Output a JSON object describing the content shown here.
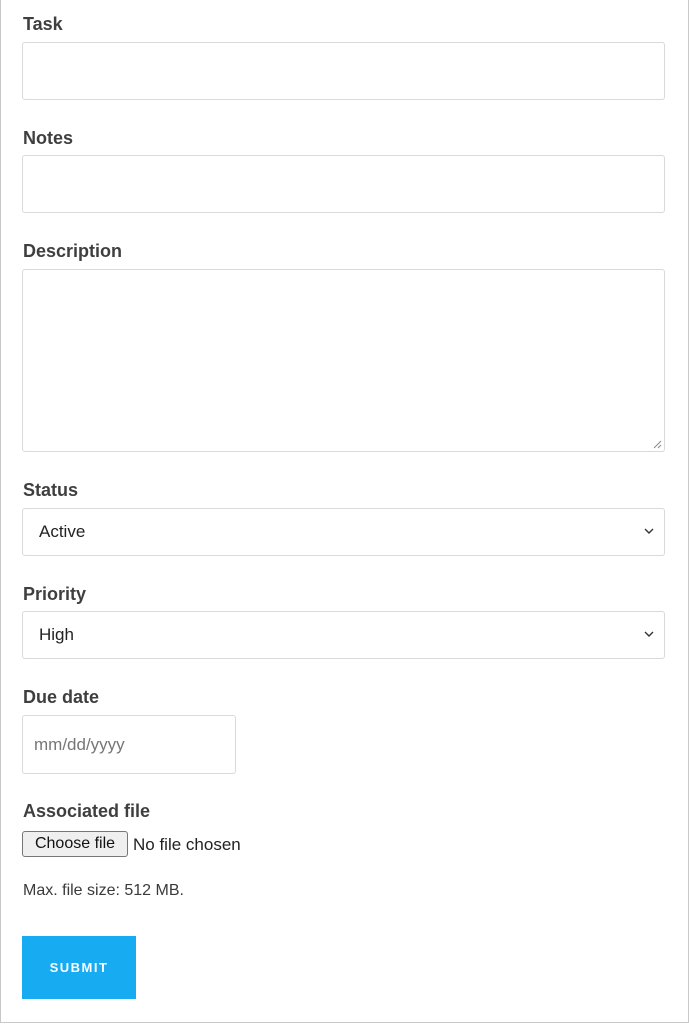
{
  "form": {
    "task": {
      "label": "Task",
      "value": ""
    },
    "notes": {
      "label": "Notes",
      "value": ""
    },
    "description": {
      "label": "Description",
      "value": ""
    },
    "status": {
      "label": "Status",
      "selected": "Active"
    },
    "priority": {
      "label": "Priority",
      "selected": "High"
    },
    "due_date": {
      "label": "Due date",
      "placeholder": "mm/dd/yyyy"
    },
    "file": {
      "label": "Associated file",
      "button_label": "Choose file",
      "status_text": "No file chosen",
      "max_size_text": "Max. file size: 512 MB."
    },
    "submit_label": "SUBMIT"
  },
  "colors": {
    "submit_bg": "#17abf2",
    "label_text": "#3f3f3f",
    "field_border": "#d9d9d9"
  },
  "icons": {
    "select_arrow": "chevron-down-icon",
    "textarea_resize": "resize-handle-icon"
  }
}
